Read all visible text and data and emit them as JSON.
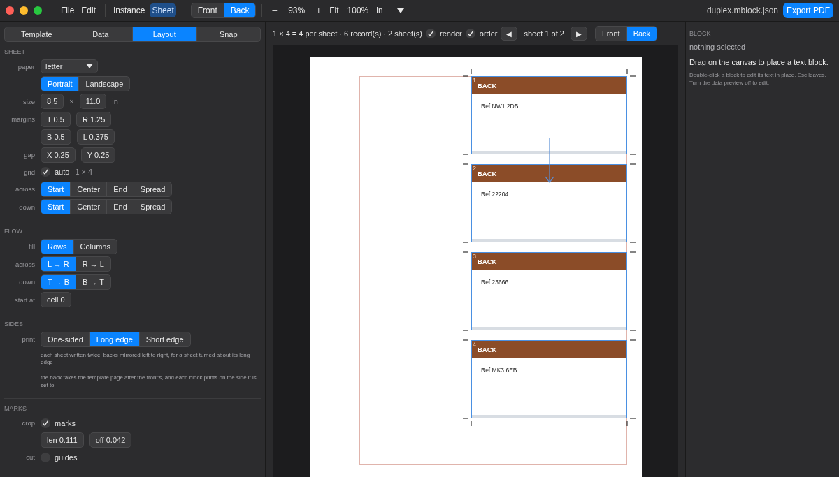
{
  "menu": [
    "File",
    "Edit"
  ],
  "mode_tabs": [
    {
      "label": "Instance",
      "selected": false
    },
    {
      "label": "Sheet",
      "selected": true
    }
  ],
  "side_tabs": [
    {
      "label": "Front",
      "selected": false
    },
    {
      "label": "Back",
      "selected": true
    }
  ],
  "zoom": {
    "out": "–",
    "value": "93%",
    "in": "+",
    "fit": "Fit",
    "actual": "100%",
    "unit": "in"
  },
  "file_name": "duplex.mblock.json",
  "export_button": "Export PDF",
  "panel_tabs": [
    {
      "label": "Template",
      "selected": false
    },
    {
      "label": "Data",
      "selected": false
    },
    {
      "label": "Layout",
      "selected": true
    },
    {
      "label": "Snap",
      "selected": false
    }
  ],
  "sections": [
    {
      "title": "SHEET",
      "rows": [
        {
          "label": "paper",
          "items": [
            {
              "kind": "dropdown",
              "value": "letter"
            }
          ]
        },
        {
          "items": [
            {
              "kind": "segmented",
              "options": [
                {
                  "label": "Portrait",
                  "selected": true
                },
                {
                  "label": "Landscape",
                  "selected": false
                }
              ]
            }
          ]
        },
        {
          "label": "size",
          "items": [
            {
              "kind": "field",
              "value": "8.5"
            },
            {
              "kind": "text",
              "text": "×"
            },
            {
              "kind": "field",
              "value": "11.0"
            },
            {
              "kind": "text",
              "text": "in"
            }
          ]
        },
        {
          "label": "margins",
          "items": [
            {
              "kind": "field",
              "value": "T 0.5"
            },
            {
              "kind": "field",
              "value": "R 1.25"
            }
          ]
        },
        {
          "items": [
            {
              "kind": "field",
              "value": "B 0.5"
            },
            {
              "kind": "field",
              "value": "L 0.375"
            }
          ]
        },
        {
          "label": "gap",
          "items": [
            {
              "kind": "field",
              "value": "X 0.25"
            },
            {
              "kind": "field",
              "value": "Y 0.25"
            }
          ]
        },
        {
          "label": "grid",
          "items": [
            {
              "kind": "checkbox",
              "label": "auto",
              "checked": true
            },
            {
              "kind": "text",
              "text": "1 × 4"
            }
          ]
        },
        {
          "label": "across",
          "items": [
            {
              "kind": "segmented",
              "options": [
                {
                  "label": "Start",
                  "selected": true
                },
                {
                  "label": "Center",
                  "selected": false
                },
                {
                  "label": "End",
                  "selected": false
                },
                {
                  "label": "Spread",
                  "selected": false
                }
              ]
            }
          ]
        },
        {
          "label": "down",
          "items": [
            {
              "kind": "segmented",
              "options": [
                {
                  "label": "Start",
                  "selected": true
                },
                {
                  "label": "Center",
                  "selected": false
                },
                {
                  "label": "End",
                  "selected": false
                },
                {
                  "label": "Spread",
                  "selected": false
                }
              ]
            }
          ]
        }
      ]
    },
    {
      "title": "FLOW",
      "rows": [
        {
          "label": "fill",
          "items": [
            {
              "kind": "segmented",
              "options": [
                {
                  "label": "Rows",
                  "selected": true
                },
                {
                  "label": "Columns",
                  "selected": false
                }
              ]
            }
          ]
        },
        {
          "label": "across",
          "items": [
            {
              "kind": "segmented",
              "options": [
                {
                  "label": "L → R",
                  "selected": true
                },
                {
                  "label": "R → L",
                  "selected": false
                }
              ]
            }
          ]
        },
        {
          "label": "down",
          "items": [
            {
              "kind": "segmented",
              "options": [
                {
                  "label": "T → B",
                  "selected": true
                },
                {
                  "label": "B → T",
                  "selected": false
                }
              ]
            }
          ]
        },
        {
          "label": "start at",
          "items": [
            {
              "kind": "field",
              "value": "cell 0"
            }
          ]
        }
      ]
    },
    {
      "title": "SIDES",
      "rows": [
        {
          "label": "print",
          "items": [
            {
              "kind": "segmented",
              "options": [
                {
                  "label": "One-sided",
                  "selected": false
                },
                {
                  "label": "Long edge",
                  "selected": true
                },
                {
                  "label": "Short edge",
                  "selected": false
                }
              ]
            }
          ]
        },
        {
          "items": [
            {
              "kind": "note",
              "text": "each sheet written twice; backs mirrored left to right, for a sheet turned about its long edge"
            }
          ]
        },
        {
          "items": [
            {
              "kind": "note",
              "text": "the back takes the template page after the front's, and each block prints on the side it is set to"
            }
          ]
        }
      ]
    },
    {
      "title": "MARKS",
      "rows": [
        {
          "label": "crop",
          "items": [
            {
              "kind": "checkbox",
              "label": "marks",
              "checked": true
            }
          ]
        },
        {
          "items": [
            {
              "kind": "field",
              "value": "len 0.111"
            },
            {
              "kind": "field",
              "value": "off 0.042"
            }
          ]
        },
        {
          "label": "cut",
          "items": [
            {
              "kind": "checkbox",
              "label": "guides",
              "checked": false
            }
          ]
        }
      ]
    }
  ],
  "canvas_toolbar": {
    "summary": "1 × 4 = 4 per sheet · 6 record(s) · 2 sheet(s)",
    "options": [
      {
        "label": "render",
        "checked": true
      },
      {
        "label": "order",
        "checked": true
      }
    ],
    "prev": "◀",
    "sheet": "sheet 1 of 2",
    "next": "▶",
    "sides": [
      {
        "label": "Front",
        "selected": false
      },
      {
        "label": "Back",
        "selected": true
      }
    ]
  },
  "sheet": {
    "blocks": [
      {
        "index": "1",
        "header": "BACK",
        "text": "Ref NW1 2DB"
      },
      {
        "index": "2",
        "header": "BACK",
        "text": "Ref 22204"
      },
      {
        "index": "3",
        "header": "BACK",
        "text": "Ref 23666"
      },
      {
        "index": "4",
        "header": "BACK",
        "text": "Ref MK3 6EB"
      }
    ]
  },
  "block_panel": {
    "title": "BLOCK",
    "status": "nothing selected",
    "instruction": "Drag on the canvas to place a text block.",
    "hint": "Double-click a block to edit its text in place. Esc leaves. Turn the data preview off to edit."
  }
}
